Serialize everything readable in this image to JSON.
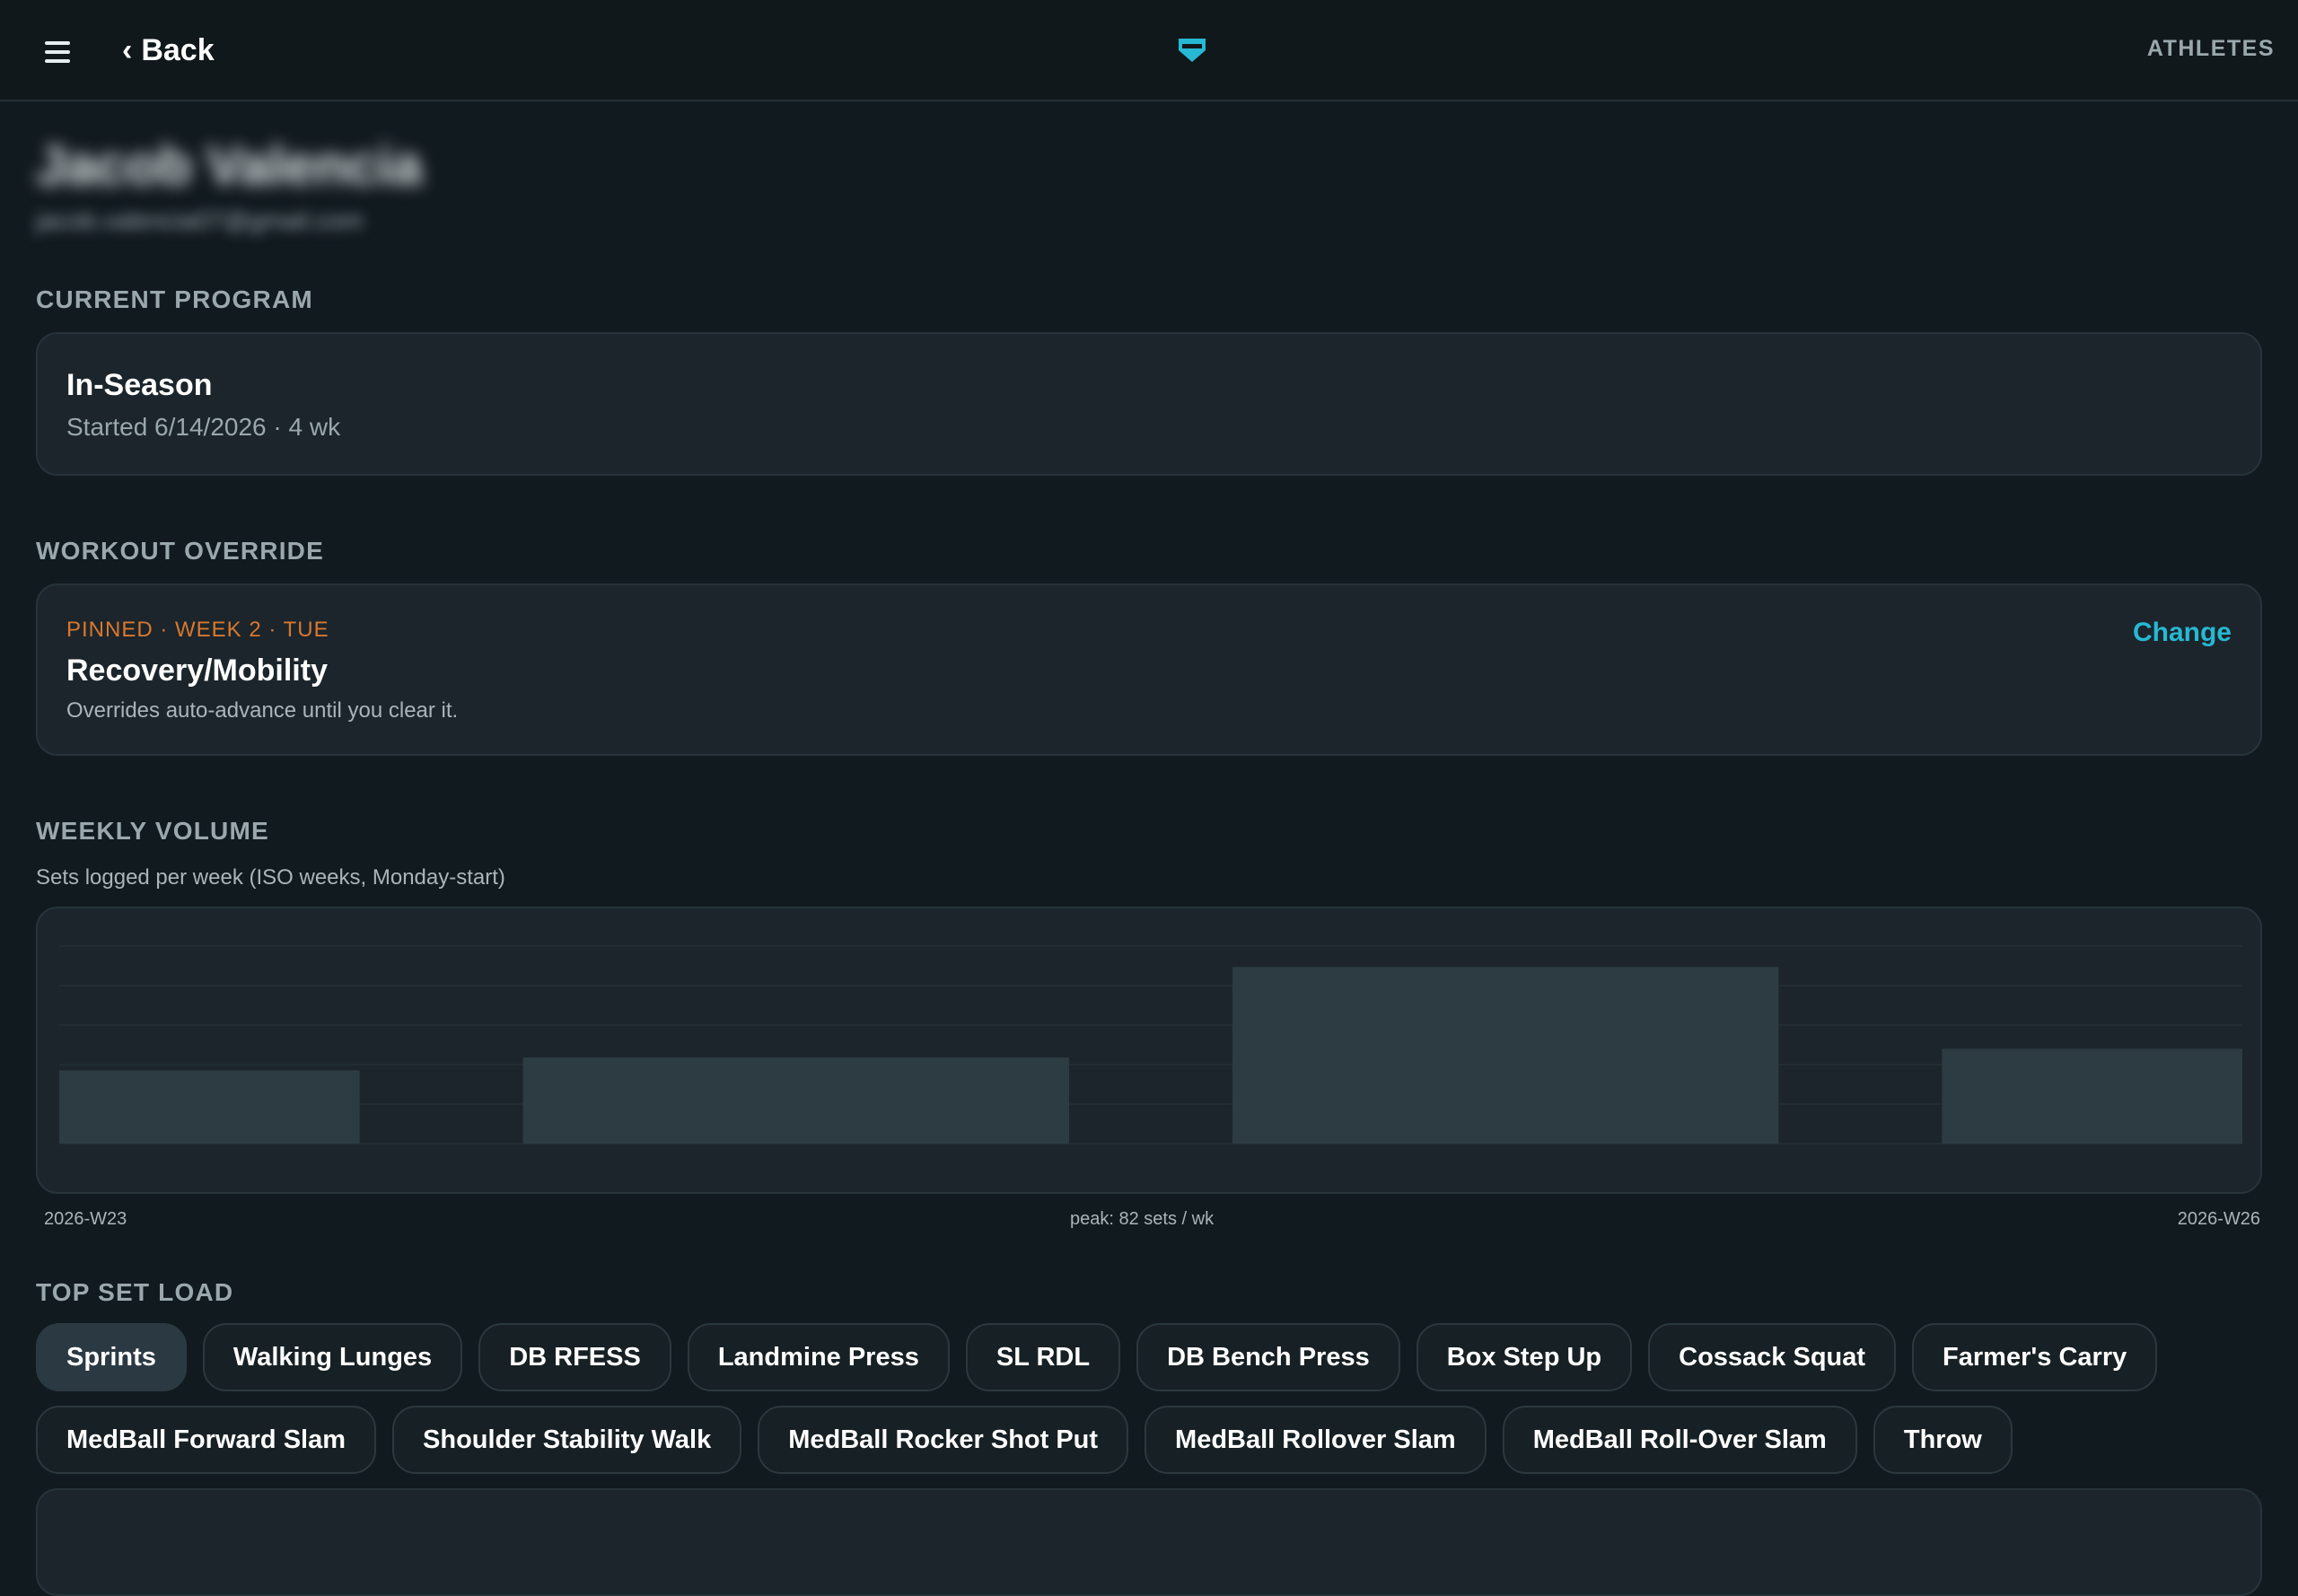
{
  "topbar": {
    "back_label": "Back",
    "right_link": "ATHLETES",
    "accent": "#27b8d3"
  },
  "athlete": {
    "name": "Jacob Valencia",
    "email": "jacob.valencia07@gmail.com"
  },
  "current_program": {
    "section_title": "CURRENT PROGRAM",
    "name": "In-Season",
    "meta": "Started 6/14/2026 · 4 wk"
  },
  "workout_override": {
    "section_title": "WORKOUT OVERRIDE",
    "pinned_label": "PINNED · WEEK 2 · TUE",
    "name": "Recovery/Mobility",
    "description": "Overrides auto-advance until you clear it.",
    "change_label": "Change",
    "pinned_color": "#d9782f"
  },
  "weekly_volume": {
    "section_title": "WEEKLY VOLUME",
    "subtitle": "Sets logged per week (ISO weeks, Monday-start)",
    "x_start_label": "2026-W23",
    "x_end_label": "2026-W26",
    "peak_label": "peak: 82 sets / wk"
  },
  "chart_data": {
    "type": "bar",
    "categories": [
      "2026-W23",
      "2026-W24",
      "2026-W25",
      "2026-W26"
    ],
    "values": [
      34,
      40,
      82,
      44
    ],
    "ylim": [
      0,
      100
    ],
    "grid": true,
    "bar_color": "#2d3b42"
  },
  "top_set_load": {
    "section_title": "TOP SET LOAD",
    "exercises": [
      "Sprints",
      "Walking Lunges",
      "DB RFESS",
      "Landmine Press",
      "SL RDL",
      "DB Bench Press",
      "Box Step Up",
      "Cossack Squat",
      "Farmer's Carry",
      "MedBall Forward Slam",
      "Shoulder Stability Walk",
      "MedBall Rocker Shot Put",
      "MedBall Rollover Slam",
      "MedBall Roll-Over Slam",
      "Throw"
    ],
    "selected": "Sprints"
  }
}
